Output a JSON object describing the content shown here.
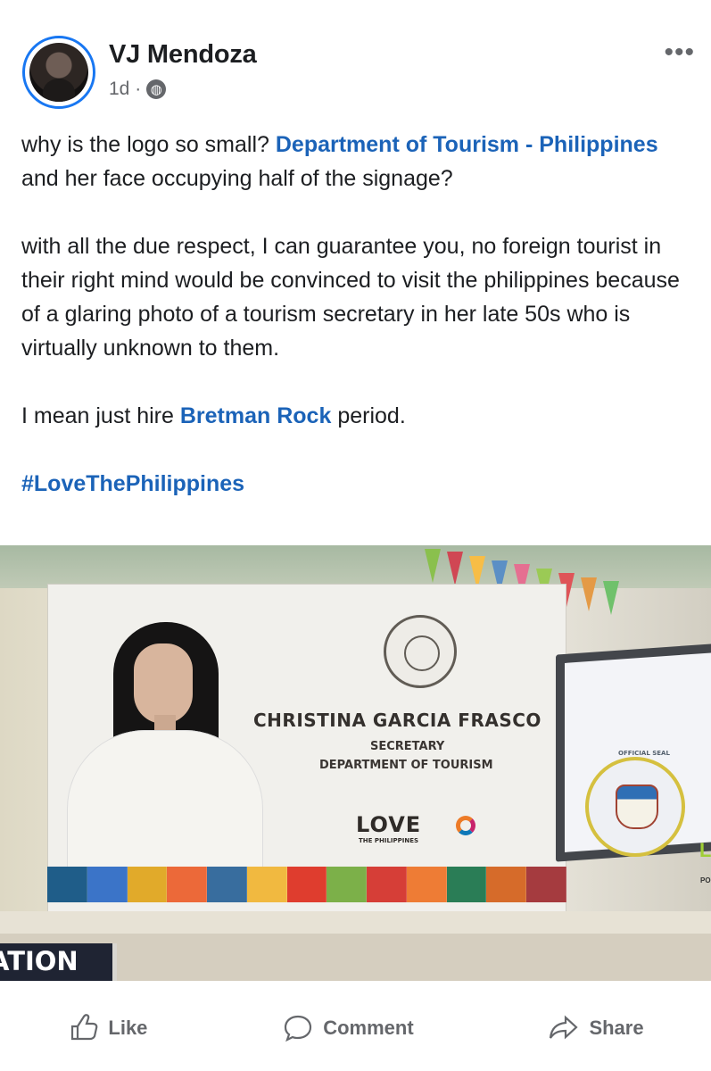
{
  "post": {
    "author": "VJ Mendoza",
    "time": "1d ·",
    "more": "•••",
    "paragraph1_before": "why is the logo so small?",
    "mention1": "Department of Tourism - Philippines",
    "paragraph1_after": "and her face occupying half of the signage?",
    "paragraph2": "with all the due respect, I can guarantee you, no foreign tourist in their right mind would be convinced to visit the philippines because of a glaring photo of a tourism secretary in her late 50s who is virtually unknown to them.",
    "paragraph3_before": "I mean just hire",
    "mention2": "Bretman Rock",
    "paragraph3_after": "period.",
    "hashtag": "#LoveThePhilippines"
  },
  "photo": {
    "sign_name": "CHRISTINA GARCIA FRASCO",
    "sign_role": "SECRETARY",
    "sign_department": "DEPARTMENT OF TOURISM",
    "love_word": "LOVE",
    "love_sub": "THE PHILIPPINES",
    "aklan_label": "OFFICIAL SEAL",
    "screen_fragment_a": "L",
    "screen_fragment_b": "PO",
    "station_fragment": "ATION"
  },
  "actions": [
    {
      "label": "Like",
      "icon": "like-icon"
    },
    {
      "label": "Comment",
      "icon": "comment-icon"
    },
    {
      "label": "Share",
      "icon": "share-icon"
    }
  ],
  "colors": {
    "link": "#1b63b8",
    "avatar_ring": "#1877f2",
    "secondary_text": "#65676b"
  }
}
